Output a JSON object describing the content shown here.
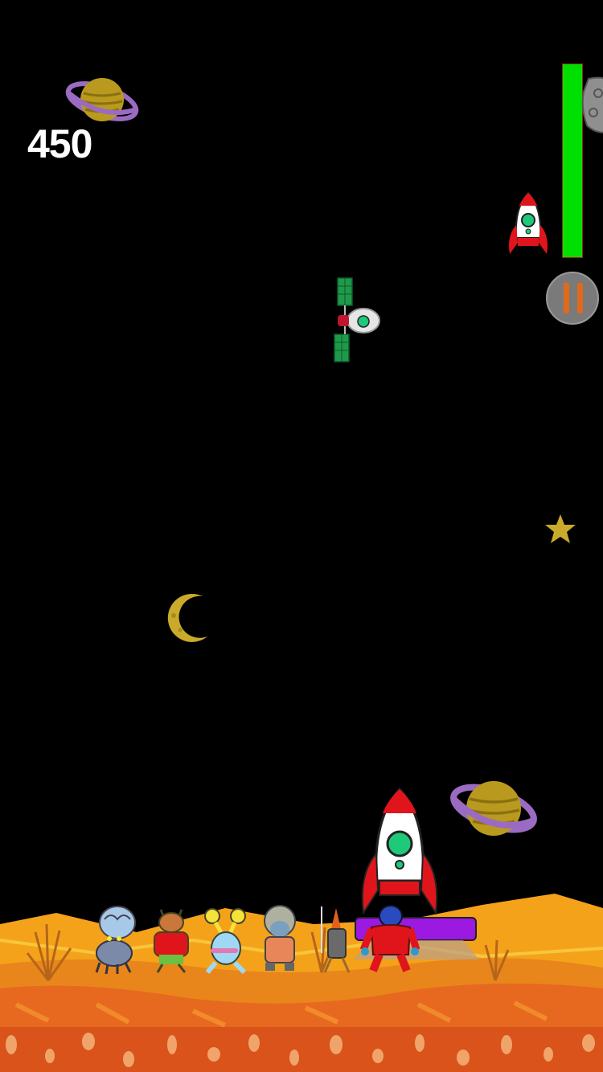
{
  "hud": {
    "score": "450",
    "fuel_level": 1.0,
    "pause_icon": "pause-icon",
    "fuel_color": "#00e000",
    "pause_color": "#e06a1a"
  },
  "scene": {
    "objects": [
      "ringed-planet-icon",
      "asteroid-icon",
      "rocket-icon",
      "satellite-icon",
      "moon-icon",
      "star-icon"
    ],
    "characters": [
      "brain-alien",
      "horned-alien",
      "yellow-eyed-alien",
      "antenna-alien",
      "carrot-knight-alien",
      "red-suit-alien"
    ],
    "colors": {
      "sky": "#000000",
      "ground": "#f5a21b",
      "lava": "#d9531b",
      "rocket_red": "#e0151b",
      "pad": "#9b19e0"
    }
  }
}
